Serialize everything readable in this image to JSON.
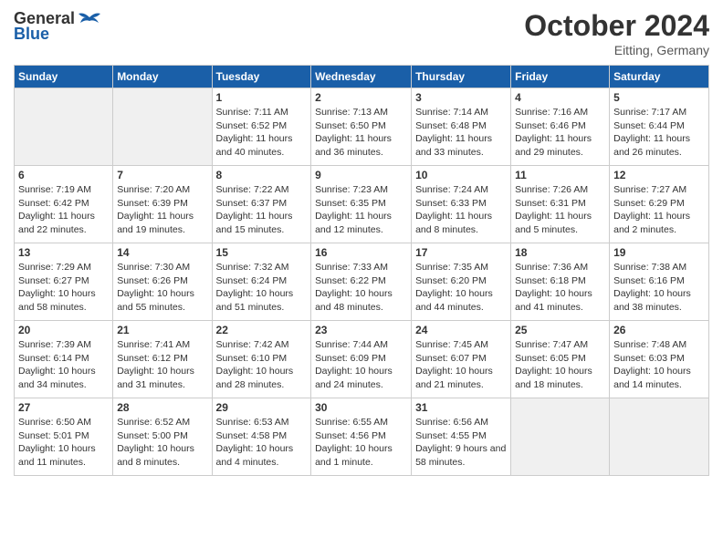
{
  "header": {
    "logo_general": "General",
    "logo_blue": "Blue",
    "month_title": "October 2024",
    "subtitle": "Eitting, Germany"
  },
  "days_of_week": [
    "Sunday",
    "Monday",
    "Tuesday",
    "Wednesday",
    "Thursday",
    "Friday",
    "Saturday"
  ],
  "weeks": [
    [
      {
        "day": "",
        "info": ""
      },
      {
        "day": "",
        "info": ""
      },
      {
        "day": "1",
        "sunrise": "7:11 AM",
        "sunset": "6:52 PM",
        "daylight": "11 hours and 40 minutes."
      },
      {
        "day": "2",
        "sunrise": "7:13 AM",
        "sunset": "6:50 PM",
        "daylight": "11 hours and 36 minutes."
      },
      {
        "day": "3",
        "sunrise": "7:14 AM",
        "sunset": "6:48 PM",
        "daylight": "11 hours and 33 minutes."
      },
      {
        "day": "4",
        "sunrise": "7:16 AM",
        "sunset": "6:46 PM",
        "daylight": "11 hours and 29 minutes."
      },
      {
        "day": "5",
        "sunrise": "7:17 AM",
        "sunset": "6:44 PM",
        "daylight": "11 hours and 26 minutes."
      }
    ],
    [
      {
        "day": "6",
        "sunrise": "7:19 AM",
        "sunset": "6:42 PM",
        "daylight": "11 hours and 22 minutes."
      },
      {
        "day": "7",
        "sunrise": "7:20 AM",
        "sunset": "6:39 PM",
        "daylight": "11 hours and 19 minutes."
      },
      {
        "day": "8",
        "sunrise": "7:22 AM",
        "sunset": "6:37 PM",
        "daylight": "11 hours and 15 minutes."
      },
      {
        "day": "9",
        "sunrise": "7:23 AM",
        "sunset": "6:35 PM",
        "daylight": "11 hours and 12 minutes."
      },
      {
        "day": "10",
        "sunrise": "7:24 AM",
        "sunset": "6:33 PM",
        "daylight": "11 hours and 8 minutes."
      },
      {
        "day": "11",
        "sunrise": "7:26 AM",
        "sunset": "6:31 PM",
        "daylight": "11 hours and 5 minutes."
      },
      {
        "day": "12",
        "sunrise": "7:27 AM",
        "sunset": "6:29 PM",
        "daylight": "11 hours and 2 minutes."
      }
    ],
    [
      {
        "day": "13",
        "sunrise": "7:29 AM",
        "sunset": "6:27 PM",
        "daylight": "10 hours and 58 minutes."
      },
      {
        "day": "14",
        "sunrise": "7:30 AM",
        "sunset": "6:26 PM",
        "daylight": "10 hours and 55 minutes."
      },
      {
        "day": "15",
        "sunrise": "7:32 AM",
        "sunset": "6:24 PM",
        "daylight": "10 hours and 51 minutes."
      },
      {
        "day": "16",
        "sunrise": "7:33 AM",
        "sunset": "6:22 PM",
        "daylight": "10 hours and 48 minutes."
      },
      {
        "day": "17",
        "sunrise": "7:35 AM",
        "sunset": "6:20 PM",
        "daylight": "10 hours and 44 minutes."
      },
      {
        "day": "18",
        "sunrise": "7:36 AM",
        "sunset": "6:18 PM",
        "daylight": "10 hours and 41 minutes."
      },
      {
        "day": "19",
        "sunrise": "7:38 AM",
        "sunset": "6:16 PM",
        "daylight": "10 hours and 38 minutes."
      }
    ],
    [
      {
        "day": "20",
        "sunrise": "7:39 AM",
        "sunset": "6:14 PM",
        "daylight": "10 hours and 34 minutes."
      },
      {
        "day": "21",
        "sunrise": "7:41 AM",
        "sunset": "6:12 PM",
        "daylight": "10 hours and 31 minutes."
      },
      {
        "day": "22",
        "sunrise": "7:42 AM",
        "sunset": "6:10 PM",
        "daylight": "10 hours and 28 minutes."
      },
      {
        "day": "23",
        "sunrise": "7:44 AM",
        "sunset": "6:09 PM",
        "daylight": "10 hours and 24 minutes."
      },
      {
        "day": "24",
        "sunrise": "7:45 AM",
        "sunset": "6:07 PM",
        "daylight": "10 hours and 21 minutes."
      },
      {
        "day": "25",
        "sunrise": "7:47 AM",
        "sunset": "6:05 PM",
        "daylight": "10 hours and 18 minutes."
      },
      {
        "day": "26",
        "sunrise": "7:48 AM",
        "sunset": "6:03 PM",
        "daylight": "10 hours and 14 minutes."
      }
    ],
    [
      {
        "day": "27",
        "sunrise": "6:50 AM",
        "sunset": "5:01 PM",
        "daylight": "10 hours and 11 minutes."
      },
      {
        "day": "28",
        "sunrise": "6:52 AM",
        "sunset": "5:00 PM",
        "daylight": "10 hours and 8 minutes."
      },
      {
        "day": "29",
        "sunrise": "6:53 AM",
        "sunset": "4:58 PM",
        "daylight": "10 hours and 4 minutes."
      },
      {
        "day": "30",
        "sunrise": "6:55 AM",
        "sunset": "4:56 PM",
        "daylight": "10 hours and 1 minute."
      },
      {
        "day": "31",
        "sunrise": "6:56 AM",
        "sunset": "4:55 PM",
        "daylight": "9 hours and 58 minutes."
      },
      {
        "day": "",
        "info": ""
      },
      {
        "day": "",
        "info": ""
      }
    ]
  ]
}
